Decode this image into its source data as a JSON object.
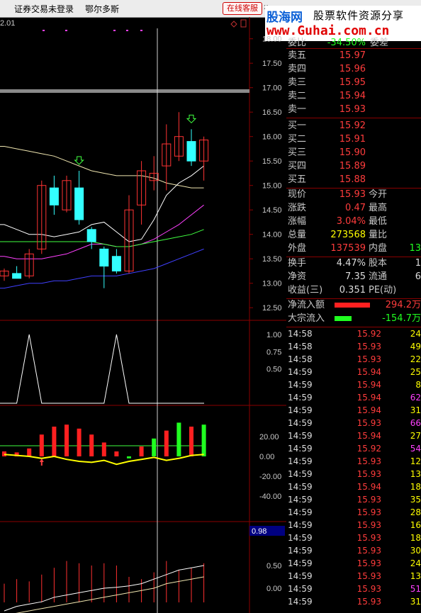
{
  "titlebar": {
    "app": "证券交易未登录",
    "stock": "鄂尔多斯",
    "online_btn": "在线客服",
    "close": "x"
  },
  "brand": {
    "site": "股海网",
    "slogan": "股票软件资源分享",
    "url": "www.Guhai.com.cn"
  },
  "chart": {
    "corner_value": "2.01",
    "price_axis": [
      "18.00",
      "17.50",
      "17.00",
      "16.50",
      "16.00",
      "15.50",
      "15.00",
      "14.50",
      "14.00",
      "13.50",
      "13.00",
      "12.50"
    ],
    "ind1_axis": [
      "1.00",
      "0.75",
      "0.50"
    ],
    "ind2_axis": [
      "20.00",
      "0.00",
      "-20.00",
      "-40.00"
    ],
    "ind3_axis": [
      "0.50",
      "0.00"
    ],
    "ind3_current": "0.98",
    "colors": {
      "up": "#ff3333",
      "down": "#33ffff",
      "grid": "#8b0000"
    },
    "chart_data": {
      "type": "candlestick",
      "ylim": [
        12.3,
        18.3
      ],
      "candles": [
        {
          "o": 13.15,
          "h": 13.3,
          "l": 13.05,
          "c": 13.25
        },
        {
          "o": 13.2,
          "h": 13.35,
          "l": 13.1,
          "c": 13.1
        },
        {
          "o": 13.15,
          "h": 13.7,
          "l": 13.1,
          "c": 13.6
        },
        {
          "o": 13.7,
          "h": 15.1,
          "l": 13.6,
          "c": 15.0
        },
        {
          "o": 14.95,
          "h": 15.2,
          "l": 14.4,
          "c": 14.6
        },
        {
          "o": 14.5,
          "h": 15.2,
          "l": 14.45,
          "c": 15.1
        },
        {
          "o": 14.95,
          "h": 15.3,
          "l": 14.2,
          "c": 14.3
        },
        {
          "o": 14.1,
          "h": 14.15,
          "l": 13.7,
          "c": 13.85
        },
        {
          "o": 13.7,
          "h": 13.75,
          "l": 12.9,
          "c": 13.35
        },
        {
          "o": 13.55,
          "h": 13.7,
          "l": 13.2,
          "c": 13.25
        },
        {
          "o": 13.25,
          "h": 14.8,
          "l": 13.2,
          "c": 14.5
        },
        {
          "o": 14.6,
          "h": 15.5,
          "l": 14.2,
          "c": 15.3
        },
        {
          "o": 15.1,
          "h": 15.6,
          "l": 14.9,
          "c": 15.25
        },
        {
          "o": 15.4,
          "h": 16.25,
          "l": 14.9,
          "c": 15.85
        },
        {
          "o": 15.6,
          "h": 16.5,
          "l": 15.5,
          "c": 16.0
        },
        {
          "o": 15.9,
          "h": 16.15,
          "l": 15.4,
          "c": 15.5
        },
        {
          "o": 15.5,
          "h": 16.0,
          "l": 15.1,
          "c": 15.93
        }
      ],
      "signal_arrows": [
        {
          "i": 6,
          "dir": "down"
        },
        {
          "i": 15,
          "dir": "down"
        }
      ],
      "ma_white": [
        14.2,
        14.1,
        14.0,
        14.0,
        13.95,
        14.0,
        14.05,
        14.2,
        14.25,
        14.05,
        13.85,
        13.9,
        14.3,
        14.8,
        15.05,
        15.2,
        15.4
      ],
      "ma_beige": [
        15.8,
        15.75,
        15.7,
        15.65,
        15.6,
        15.5,
        15.4,
        15.3,
        15.25,
        15.2,
        15.2,
        15.2,
        15.15,
        15.05,
        15.0,
        14.95,
        14.95
      ],
      "ma_magenta": [
        13.55,
        13.5,
        13.5,
        13.5,
        13.55,
        13.6,
        13.7,
        13.8,
        13.8,
        13.75,
        13.75,
        13.8,
        13.9,
        14.05,
        14.2,
        14.4,
        14.6
      ],
      "ma_green": [
        13.85,
        13.85,
        13.85,
        13.85,
        13.85,
        13.85,
        13.85,
        13.85,
        13.8,
        13.75,
        13.75,
        13.8,
        13.85,
        13.9,
        13.95,
        14.0,
        14.1
      ],
      "ma_blue": [
        12.9,
        12.95,
        13.0,
        13.0,
        13.05,
        13.05,
        13.1,
        13.15,
        13.15,
        13.15,
        13.2,
        13.25,
        13.3,
        13.4,
        13.5,
        13.6,
        13.7
      ],
      "ind1": [
        0,
        0,
        1,
        0,
        0,
        0,
        0,
        0,
        0,
        1,
        0,
        0,
        0,
        0,
        0,
        0,
        0
      ],
      "ind2_bars": [
        5,
        4,
        8,
        22,
        30,
        32,
        28,
        22,
        14,
        5,
        -2,
        10,
        18,
        26,
        34,
        30,
        32
      ],
      "ind2_line": [
        2,
        1,
        0,
        -2,
        0,
        -3,
        -5,
        -6,
        -4,
        -8,
        -5,
        -3,
        -1,
        -4,
        -2,
        1,
        2
      ],
      "ind3_vol": [
        0.1,
        0.2,
        0.15,
        0.3,
        0.45,
        0.6,
        0.55,
        0.5,
        0.55,
        0.5,
        0.25,
        0.2,
        0.35,
        0.6,
        0.4,
        0.45,
        0.55
      ],
      "ind3_line": [
        -0.5,
        -0.4,
        -0.35,
        -0.3,
        -0.2,
        -0.15,
        -0.1,
        -0.05,
        0.0,
        0.02,
        0.05,
        0.1,
        0.2,
        0.3,
        0.4,
        0.45,
        0.5
      ],
      "ind3_line2": [
        -0.6,
        -0.55,
        -0.5,
        -0.45,
        -0.4,
        -0.35,
        -0.3,
        -0.25,
        -0.2,
        -0.15,
        -0.1,
        -0.05,
        0.0,
        0.1,
        0.15,
        0.2,
        0.25
      ]
    }
  },
  "quote": {
    "weibi": {
      "label": "委比",
      "value": "-34.50%",
      "label2": "委差"
    },
    "sell": [
      {
        "label": "卖五",
        "price": "15.97"
      },
      {
        "label": "卖四",
        "price": "15.96"
      },
      {
        "label": "卖三",
        "price": "15.95"
      },
      {
        "label": "卖二",
        "price": "15.94"
      },
      {
        "label": "卖一",
        "price": "15.93"
      }
    ],
    "buy": [
      {
        "label": "买一",
        "price": "15.92"
      },
      {
        "label": "买二",
        "price": "15.91"
      },
      {
        "label": "买三",
        "price": "15.90"
      },
      {
        "label": "买四",
        "price": "15.89"
      },
      {
        "label": "买五",
        "price": "15.88"
      }
    ],
    "stats": [
      {
        "l1": "现价",
        "v1": "15.93",
        "l2": "今开",
        "v2": "",
        "c": "#ff3c3c"
      },
      {
        "l1": "涨跌",
        "v1": "0.47",
        "l2": "最高",
        "v2": "",
        "c": "#ff3c3c"
      },
      {
        "l1": "涨幅",
        "v1": "3.04%",
        "l2": "最低",
        "v2": "",
        "c": "#ff3c3c"
      },
      {
        "l1": "总量",
        "v1": "273568",
        "l2": "量比",
        "v2": "",
        "c": "#ffff00"
      },
      {
        "l1": "外盘",
        "v1": "137539",
        "l2": "内盘",
        "v2": "13",
        "c": "#ff3c3c"
      }
    ],
    "stats2": [
      {
        "l1": "换手",
        "v1": "4.47%",
        "l2": "股本",
        "v2": "1",
        "c": "#dcdcdc"
      },
      {
        "l1": "净资",
        "v1": "7.35",
        "l2": "流通",
        "v2": "6",
        "c": "#dcdcdc"
      },
      {
        "l1": "收益(三)",
        "v1": "0.351",
        "l2": "PE(动)",
        "v2": "",
        "c": "#dcdcdc"
      }
    ],
    "flow": [
      {
        "label": "净流入额",
        "value": "294.2万",
        "color": "#ff2020"
      },
      {
        "label": "大宗流入",
        "value": "-154.7万",
        "color": "#20ff20"
      }
    ],
    "ticks": [
      {
        "t": "14:58",
        "p": "15.92",
        "v": "24",
        "c": "#ffff00"
      },
      {
        "t": "14:58",
        "p": "15.93",
        "v": "49",
        "c": "#ffff00"
      },
      {
        "t": "14:58",
        "p": "15.93",
        "v": "22",
        "c": "#ffff00"
      },
      {
        "t": "14:59",
        "p": "15.94",
        "v": "25",
        "c": "#ffff00"
      },
      {
        "t": "14:59",
        "p": "15.94",
        "v": "8",
        "c": "#ffff00"
      },
      {
        "t": "14:59",
        "p": "15.94",
        "v": "62",
        "c": "#ff40ff"
      },
      {
        "t": "14:59",
        "p": "15.94",
        "v": "31",
        "c": "#ffff00"
      },
      {
        "t": "14:59",
        "p": "15.93",
        "v": "66",
        "c": "#ff40ff"
      },
      {
        "t": "14:59",
        "p": "15.94",
        "v": "27",
        "c": "#ffff00"
      },
      {
        "t": "14:59",
        "p": "15.92",
        "v": "54",
        "c": "#ff40ff"
      },
      {
        "t": "14:59",
        "p": "15.93",
        "v": "12",
        "c": "#ffff00"
      },
      {
        "t": "14:59",
        "p": "15.93",
        "v": "13",
        "c": "#ffff00"
      },
      {
        "t": "14:59",
        "p": "15.94",
        "v": "18",
        "c": "#ffff00"
      },
      {
        "t": "14:59",
        "p": "15.93",
        "v": "35",
        "c": "#ffff00"
      },
      {
        "t": "14:59",
        "p": "15.93",
        "v": "28",
        "c": "#ffff00"
      },
      {
        "t": "14:59",
        "p": "15.93",
        "v": "16",
        "c": "#ffff00"
      },
      {
        "t": "14:59",
        "p": "15.93",
        "v": "18",
        "c": "#ffff00"
      },
      {
        "t": "14:59",
        "p": "15.93",
        "v": "30",
        "c": "#ffff00"
      },
      {
        "t": "14:59",
        "p": "15.93",
        "v": "24",
        "c": "#ffff00"
      },
      {
        "t": "14:59",
        "p": "15.93",
        "v": "13",
        "c": "#ffff00"
      },
      {
        "t": "14:59",
        "p": "15.93",
        "v": "51",
        "c": "#ff40ff"
      },
      {
        "t": "14:59",
        "p": "15.93",
        "v": "31",
        "c": "#ffff00"
      }
    ]
  }
}
